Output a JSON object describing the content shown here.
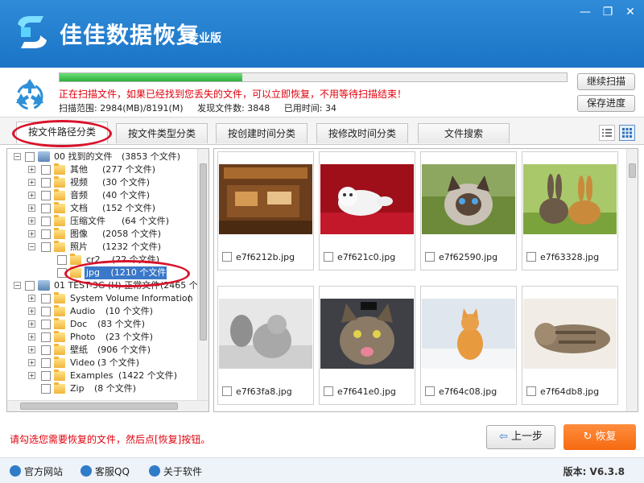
{
  "app": {
    "title": "佳佳数据恢复",
    "edition": "专业版"
  },
  "window": {
    "minimize": "—",
    "restore": "❐",
    "close": "✕"
  },
  "scan": {
    "progress": 0.36,
    "message": "正在扫描文件，如果已经找到您丢失的文件，可以立即恢复，不用等待扫描结束！",
    "range": "扫描范围: 2984(MB)/8191(M)",
    "found": "发现文件数: 3848",
    "elapsed": "已用时间: 34",
    "continue_btn": "继续扫描",
    "save_btn": "保存进度"
  },
  "tabs": [
    {
      "label": "按文件路径分类"
    },
    {
      "label": "按文件类型分类"
    },
    {
      "label": "按创建时间分类"
    },
    {
      "label": "按修改时间分类"
    },
    {
      "label": "文件搜索"
    }
  ],
  "tree": [
    {
      "label": "00 找到的文件",
      "count": "(3853 个文件)"
    },
    {
      "label": "其他",
      "count": "(277 个文件)"
    },
    {
      "label": "视频",
      "count": "(30 个文件)"
    },
    {
      "label": "音频",
      "count": "(40 个文件)"
    },
    {
      "label": "文档",
      "count": "(152 个文件)"
    },
    {
      "label": "压缩文件",
      "count": "(64 个文件)"
    },
    {
      "label": "图像",
      "count": "(2058 个文件)"
    },
    {
      "label": "照片",
      "count": "(1232 个文件)"
    },
    {
      "label": "cr2",
      "count": "(22 个文件)"
    },
    {
      "label": "jpg",
      "count": "(1210 个文件)"
    },
    {
      "label": "01 TEST-3G (H) 正常文件",
      "count": "(2465 个"
    },
    {
      "label": "System Volume Information",
      "count": "("
    },
    {
      "label": "Audio",
      "count": "(10 个文件)"
    },
    {
      "label": "Doc",
      "count": "(83 个文件)"
    },
    {
      "label": "Photo",
      "count": "(23 个文件)"
    },
    {
      "label": "壁纸",
      "count": "(906 个文件)"
    },
    {
      "label": "Video",
      "count": "(3 个文件)"
    },
    {
      "label": "Examples",
      "count": "(1422 个文件)"
    },
    {
      "label": "Zip",
      "count": "(8 个文件)"
    }
  ],
  "thumbnails": [
    {
      "name": "e7f6212b.jpg"
    },
    {
      "name": "e7f621c0.jpg"
    },
    {
      "name": "e7f62590.jpg"
    },
    {
      "name": "e7f63328.jpg"
    },
    {
      "name": "e7f63fa8.jpg"
    },
    {
      "name": "e7f641e0.jpg"
    },
    {
      "name": "e7f64c08.jpg"
    },
    {
      "name": "e7f64db8.jpg"
    }
  ],
  "bottom": {
    "hint": "请勾选您需要恢复的文件，然后点[恢复]按钮。",
    "prev_btn": "上一步",
    "recover_btn": "恢复"
  },
  "footer": {
    "site": "官方网站",
    "qq": "客服QQ",
    "about": "关于软件",
    "version": "版本: V6.3.8"
  },
  "colors": {
    "titlebar": "#1b74c6",
    "accent_orange": "#f56a10",
    "warn_red": "#e0000d",
    "progress_green": "#2ab03a"
  }
}
